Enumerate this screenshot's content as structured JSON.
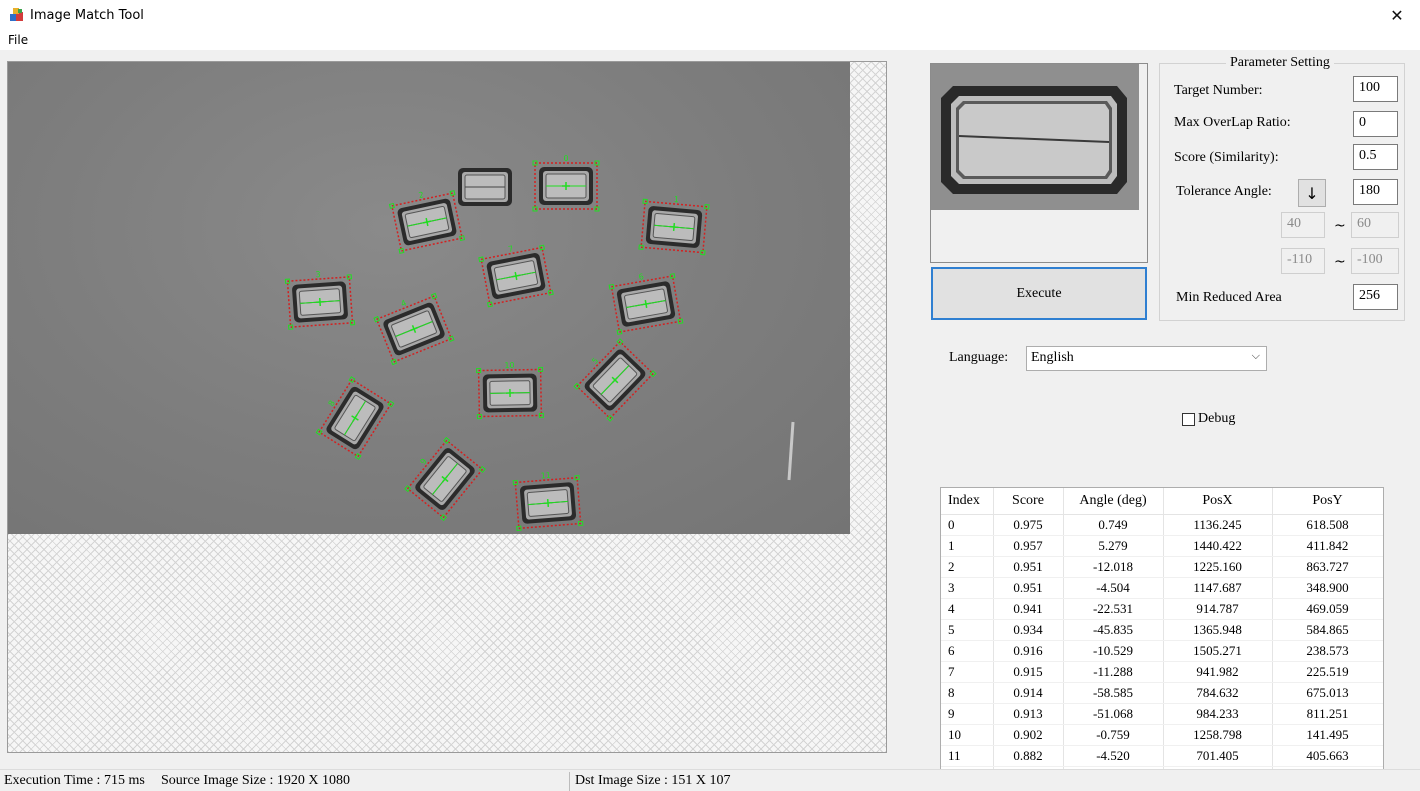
{
  "window": {
    "title": "Image Match Tool",
    "close_glyph": "✕",
    "icon": "app-blocks-icon"
  },
  "menu": {
    "file": "File"
  },
  "execute": {
    "label": "Execute"
  },
  "params": {
    "group_title": "Parameter Setting",
    "target_number_label": "Target Number:",
    "target_number_value": "100",
    "overlap_label": "Max OverLap Ratio:",
    "overlap_value": "0",
    "score_label": "Score (Similarity):",
    "score_value": "0.5",
    "tolerance_label": "Tolerance Angle:",
    "tolerance_value": "180",
    "arrow_glyph": "↓",
    "range1_min": "40",
    "range1_max": "60",
    "range2_min": "-110",
    "range2_max": "-100",
    "tilde": "~",
    "min_reduced_label": "Min Reduced Area",
    "min_reduced_value": "256"
  },
  "language": {
    "label": "Language:",
    "selected": "English"
  },
  "debug": {
    "label": "Debug",
    "checked": false
  },
  "results": {
    "headers": [
      "Index",
      "Score",
      "Angle (deg)",
      "PosX",
      "PosY"
    ],
    "rows": [
      [
        "0",
        "0.975",
        "0.749",
        "1136.245",
        "618.508"
      ],
      [
        "1",
        "0.957",
        "5.279",
        "1440.422",
        "411.842"
      ],
      [
        "2",
        "0.951",
        "-12.018",
        "1225.160",
        "863.727"
      ],
      [
        "3",
        "0.951",
        "-4.504",
        "1147.687",
        "348.900"
      ],
      [
        "4",
        "0.941",
        "-22.531",
        "914.787",
        "469.059"
      ],
      [
        "5",
        "0.934",
        "-45.835",
        "1365.948",
        "584.865"
      ],
      [
        "6",
        "0.916",
        "-10.529",
        "1505.271",
        "238.573"
      ],
      [
        "7",
        "0.915",
        "-11.288",
        "941.982",
        "225.519"
      ],
      [
        "8",
        "0.914",
        "-58.585",
        "784.632",
        "675.013"
      ],
      [
        "9",
        "0.913",
        "-51.068",
        "984.233",
        "811.251"
      ],
      [
        "10",
        "0.902",
        "-0.759",
        "1258.798",
        "141.495"
      ],
      [
        "11",
        "0.882",
        "-4.520",
        "701.405",
        "405.663"
      ]
    ]
  },
  "status": {
    "execution_time": "Execution Time : 715 ms",
    "source_size": "Source Image Size : 1920 X 1080",
    "dst_size": "Dst Image Size : 151 X 107"
  },
  "colors": {
    "accent_border": "#2f7fd1",
    "match_outline": "#d42020",
    "match_marker": "#22dd22"
  }
}
